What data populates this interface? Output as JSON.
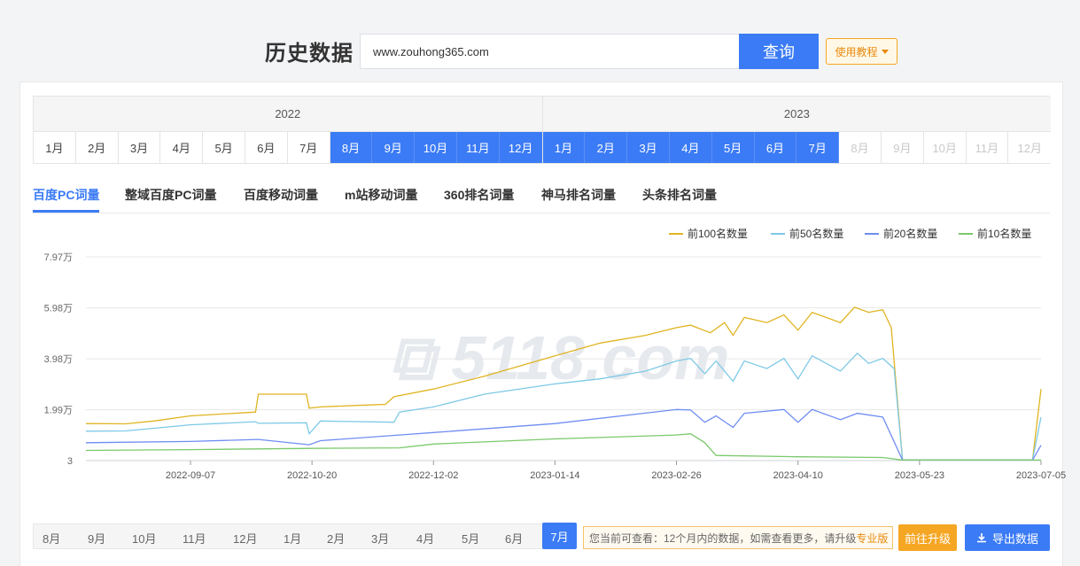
{
  "header": {
    "title": "历史数据",
    "domain_value": "www.zouhong365.com",
    "query_label": "查询",
    "tutorial_label": "使用教程"
  },
  "month_table": {
    "years": [
      {
        "year": "2022",
        "months": [
          {
            "label": "1月",
            "state": "normal"
          },
          {
            "label": "2月",
            "state": "normal"
          },
          {
            "label": "3月",
            "state": "normal"
          },
          {
            "label": "4月",
            "state": "normal"
          },
          {
            "label": "5月",
            "state": "normal"
          },
          {
            "label": "6月",
            "state": "normal"
          },
          {
            "label": "7月",
            "state": "normal"
          },
          {
            "label": "8月",
            "state": "active"
          },
          {
            "label": "9月",
            "state": "active"
          },
          {
            "label": "10月",
            "state": "active"
          },
          {
            "label": "11月",
            "state": "active"
          },
          {
            "label": "12月",
            "state": "active"
          }
        ]
      },
      {
        "year": "2023",
        "months": [
          {
            "label": "1月",
            "state": "active"
          },
          {
            "label": "2月",
            "state": "active"
          },
          {
            "label": "3月",
            "state": "active"
          },
          {
            "label": "4月",
            "state": "active"
          },
          {
            "label": "5月",
            "state": "active"
          },
          {
            "label": "6月",
            "state": "active"
          },
          {
            "label": "7月",
            "state": "active"
          },
          {
            "label": "8月",
            "state": "disabled"
          },
          {
            "label": "9月",
            "state": "disabled"
          },
          {
            "label": "10月",
            "state": "disabled"
          },
          {
            "label": "11月",
            "state": "disabled"
          },
          {
            "label": "12月",
            "state": "disabled"
          }
        ]
      }
    ]
  },
  "tabs": [
    {
      "label": "百度PC词量",
      "active": true
    },
    {
      "label": "整域百度PC词量",
      "active": false
    },
    {
      "label": "百度移动词量",
      "active": false
    },
    {
      "label": "m站移动词量",
      "active": false
    },
    {
      "label": "360排名词量",
      "active": false
    },
    {
      "label": "神马排名词量",
      "active": false
    },
    {
      "label": "头条排名词量",
      "active": false
    }
  ],
  "chart_data": {
    "type": "line",
    "x_tick_labels": [
      "2022-09-07",
      "2022-10-20",
      "2022-12-02",
      "2023-01-14",
      "2023-02-26",
      "2023-04-10",
      "2023-05-23",
      "2023-07-05"
    ],
    "x_range": [
      "2022-08-01",
      "2023-07-05"
    ],
    "y_tick_labels": [
      "3",
      "1.99万",
      "3.98万",
      "5.98万",
      "7.97万"
    ],
    "ylim": [
      3,
      79700
    ],
    "grid": true,
    "legend_position": "top-right",
    "series": [
      {
        "name": "前100名数量",
        "color": "#e0b421",
        "points": [
          [
            "2022-08-01",
            14500
          ],
          [
            "2022-08-15",
            14400
          ],
          [
            "2022-08-25",
            15500
          ],
          [
            "2022-09-07",
            17500
          ],
          [
            "2022-09-30",
            19000
          ],
          [
            "2022-10-01",
            26000
          ],
          [
            "2022-10-18",
            26000
          ],
          [
            "2022-10-19",
            20500
          ],
          [
            "2022-10-23",
            21000
          ],
          [
            "2022-11-05",
            21600
          ],
          [
            "2022-11-15",
            22000
          ],
          [
            "2022-11-18",
            25000
          ],
          [
            "2022-12-02",
            28000
          ],
          [
            "2022-12-20",
            33000
          ],
          [
            "2023-01-14",
            41000
          ],
          [
            "2023-01-30",
            46000
          ],
          [
            "2023-02-15",
            49000
          ],
          [
            "2023-02-26",
            52000
          ],
          [
            "2023-03-03",
            53000
          ],
          [
            "2023-03-10",
            50000
          ],
          [
            "2023-03-15",
            54000
          ],
          [
            "2023-03-18",
            49000
          ],
          [
            "2023-03-22",
            56000
          ],
          [
            "2023-03-30",
            54000
          ],
          [
            "2023-04-05",
            57000
          ],
          [
            "2023-04-10",
            51000
          ],
          [
            "2023-04-15",
            58000
          ],
          [
            "2023-04-25",
            54000
          ],
          [
            "2023-04-30",
            60000
          ],
          [
            "2023-05-05",
            58000
          ],
          [
            "2023-05-10",
            59000
          ],
          [
            "2023-05-13",
            52000
          ],
          [
            "2023-05-17",
            200
          ],
          [
            "2023-07-02",
            200
          ],
          [
            "2023-07-05",
            28000
          ]
        ]
      },
      {
        "name": "前50名数量",
        "color": "#7ec9e6",
        "points": [
          [
            "2022-08-01",
            11500
          ],
          [
            "2022-08-15",
            11600
          ],
          [
            "2022-09-07",
            14000
          ],
          [
            "2022-09-30",
            15200
          ],
          [
            "2022-10-01",
            14600
          ],
          [
            "2022-10-18",
            14800
          ],
          [
            "2022-10-19",
            10500
          ],
          [
            "2022-10-23",
            15500
          ],
          [
            "2022-11-18",
            15000
          ],
          [
            "2022-11-20",
            19000
          ],
          [
            "2022-12-02",
            21000
          ],
          [
            "2022-12-20",
            26000
          ],
          [
            "2023-01-14",
            30000
          ],
          [
            "2023-01-30",
            32000
          ],
          [
            "2023-02-15",
            35000
          ],
          [
            "2023-02-26",
            39000
          ],
          [
            "2023-03-03",
            40000
          ],
          [
            "2023-03-08",
            34000
          ],
          [
            "2023-03-12",
            39000
          ],
          [
            "2023-03-18",
            31000
          ],
          [
            "2023-03-22",
            39000
          ],
          [
            "2023-03-30",
            36000
          ],
          [
            "2023-04-05",
            40000
          ],
          [
            "2023-04-10",
            32000
          ],
          [
            "2023-04-15",
            41000
          ],
          [
            "2023-04-25",
            35000
          ],
          [
            "2023-05-01",
            42000
          ],
          [
            "2023-05-05",
            38000
          ],
          [
            "2023-05-10",
            40000
          ],
          [
            "2023-05-14",
            36000
          ],
          [
            "2023-05-17",
            200
          ],
          [
            "2023-07-02",
            200
          ],
          [
            "2023-07-05",
            17000
          ]
        ]
      },
      {
        "name": "前20名数量",
        "color": "#6f8df2",
        "points": [
          [
            "2022-08-01",
            7000
          ],
          [
            "2022-09-07",
            7500
          ],
          [
            "2022-10-01",
            8300
          ],
          [
            "2022-10-19",
            6200
          ],
          [
            "2022-10-23",
            7800
          ],
          [
            "2022-11-20",
            10000
          ],
          [
            "2022-12-02",
            11000
          ],
          [
            "2023-01-14",
            14500
          ],
          [
            "2023-02-26",
            20000
          ],
          [
            "2023-03-03",
            19800
          ],
          [
            "2023-03-08",
            15000
          ],
          [
            "2023-03-12",
            17500
          ],
          [
            "2023-03-18",
            13000
          ],
          [
            "2023-03-22",
            18500
          ],
          [
            "2023-04-05",
            20000
          ],
          [
            "2023-04-10",
            15000
          ],
          [
            "2023-04-15",
            20000
          ],
          [
            "2023-04-25",
            16000
          ],
          [
            "2023-05-01",
            18500
          ],
          [
            "2023-05-10",
            17000
          ],
          [
            "2023-05-17",
            200
          ],
          [
            "2023-07-02",
            200
          ],
          [
            "2023-07-05",
            6000
          ]
        ]
      },
      {
        "name": "前10名数量",
        "color": "#7ac96b",
        "points": [
          [
            "2022-08-01",
            4000
          ],
          [
            "2022-09-07",
            4300
          ],
          [
            "2022-10-20",
            4800
          ],
          [
            "2022-11-20",
            5000
          ],
          [
            "2022-12-02",
            6500
          ],
          [
            "2023-01-14",
            8500
          ],
          [
            "2023-02-26",
            10000
          ],
          [
            "2023-03-03",
            10500
          ],
          [
            "2023-03-08",
            7000
          ],
          [
            "2023-03-12",
            2000
          ],
          [
            "2023-04-10",
            1500
          ],
          [
            "2023-05-10",
            1200
          ],
          [
            "2023-05-17",
            200
          ],
          [
            "2023-07-02",
            200
          ],
          [
            "2023-07-05",
            200
          ]
        ]
      }
    ]
  },
  "bottom": {
    "months": [
      {
        "label": "8月",
        "active": false
      },
      {
        "label": "9月",
        "active": false
      },
      {
        "label": "10月",
        "active": false
      },
      {
        "label": "11月",
        "active": false
      },
      {
        "label": "12月",
        "active": false
      },
      {
        "label": "1月",
        "active": false
      },
      {
        "label": "2月",
        "active": false
      },
      {
        "label": "3月",
        "active": false
      },
      {
        "label": "4月",
        "active": false
      },
      {
        "label": "5月",
        "active": false
      },
      {
        "label": "6月",
        "active": false
      },
      {
        "label": "7月",
        "active": true
      }
    ],
    "note_prefix": "您当前可查看：12个月内的数据，如需查看更多，请升级",
    "note_link": "专业版",
    "upgrade_label": "前往升级",
    "export_label": "导出数据",
    "export_icon": "download-icon"
  }
}
